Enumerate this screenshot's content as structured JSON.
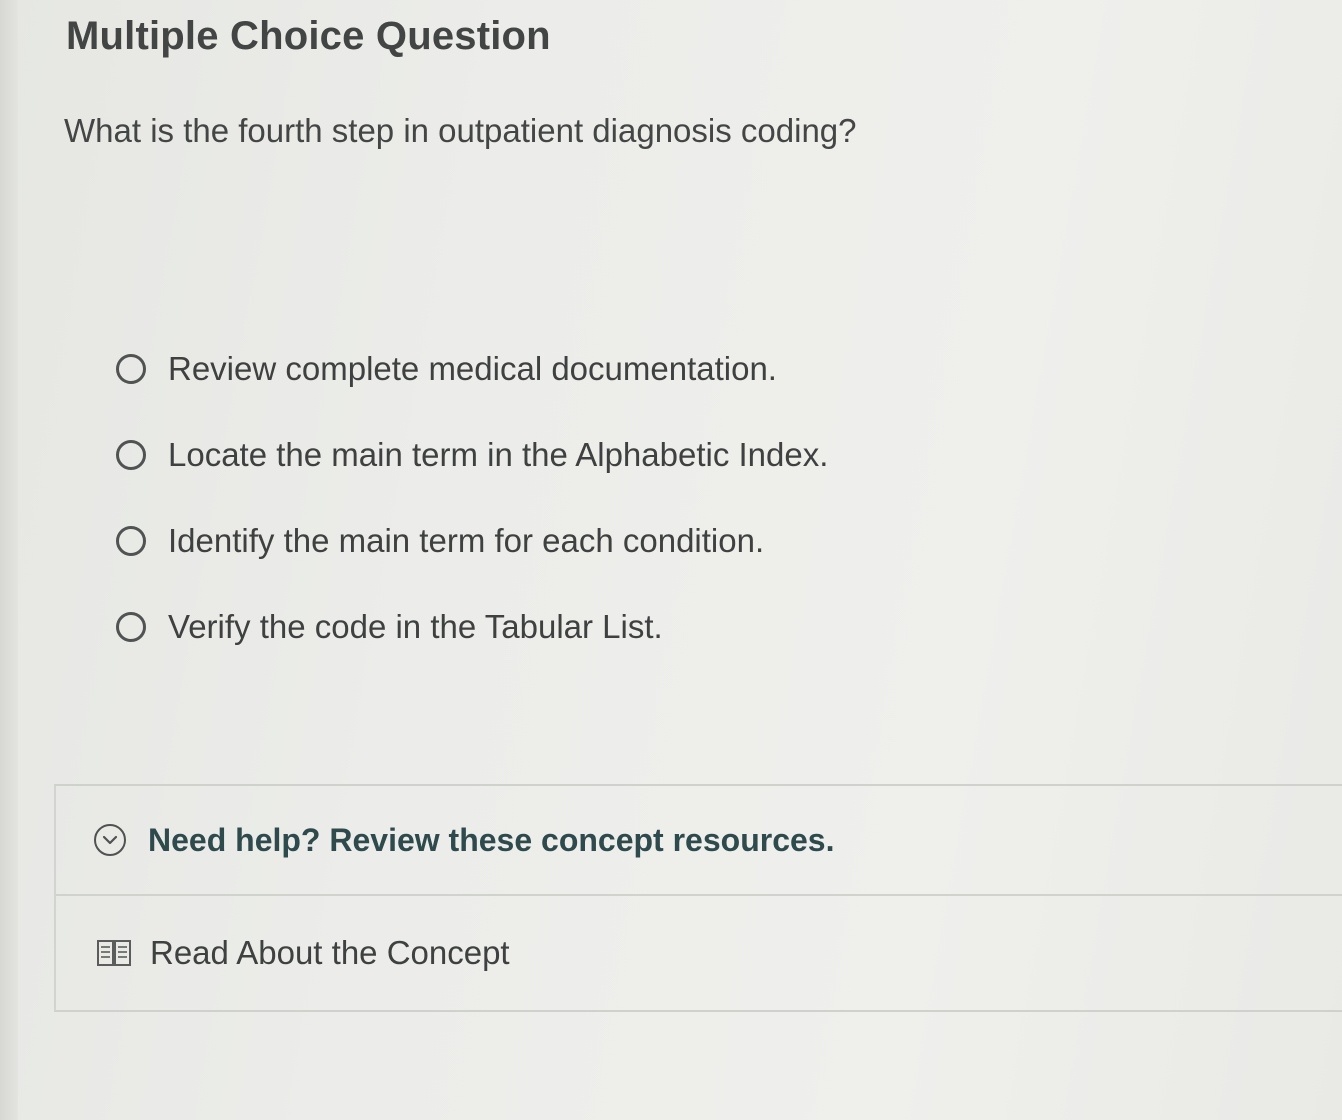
{
  "header": {
    "title": "Multiple Choice Question"
  },
  "question": {
    "text": "What is the fourth step in outpatient diagnosis coding?",
    "options": [
      {
        "label": "Review complete medical documentation."
      },
      {
        "label": "Locate the main term in the Alphabetic Index."
      },
      {
        "label": "Identify the main term for each condition."
      },
      {
        "label": "Verify the code in the Tabular List."
      }
    ]
  },
  "help": {
    "title": "Need help? Review these concept resources.",
    "icon": "chevron-down-circle-icon",
    "resources": [
      {
        "label": "Read About the Concept",
        "icon": "book-icon"
      }
    ]
  },
  "colors": {
    "background": "#ecedea",
    "text": "#3f4140",
    "help_title": "#2f4a4d",
    "border": "#cfd1cd"
  }
}
